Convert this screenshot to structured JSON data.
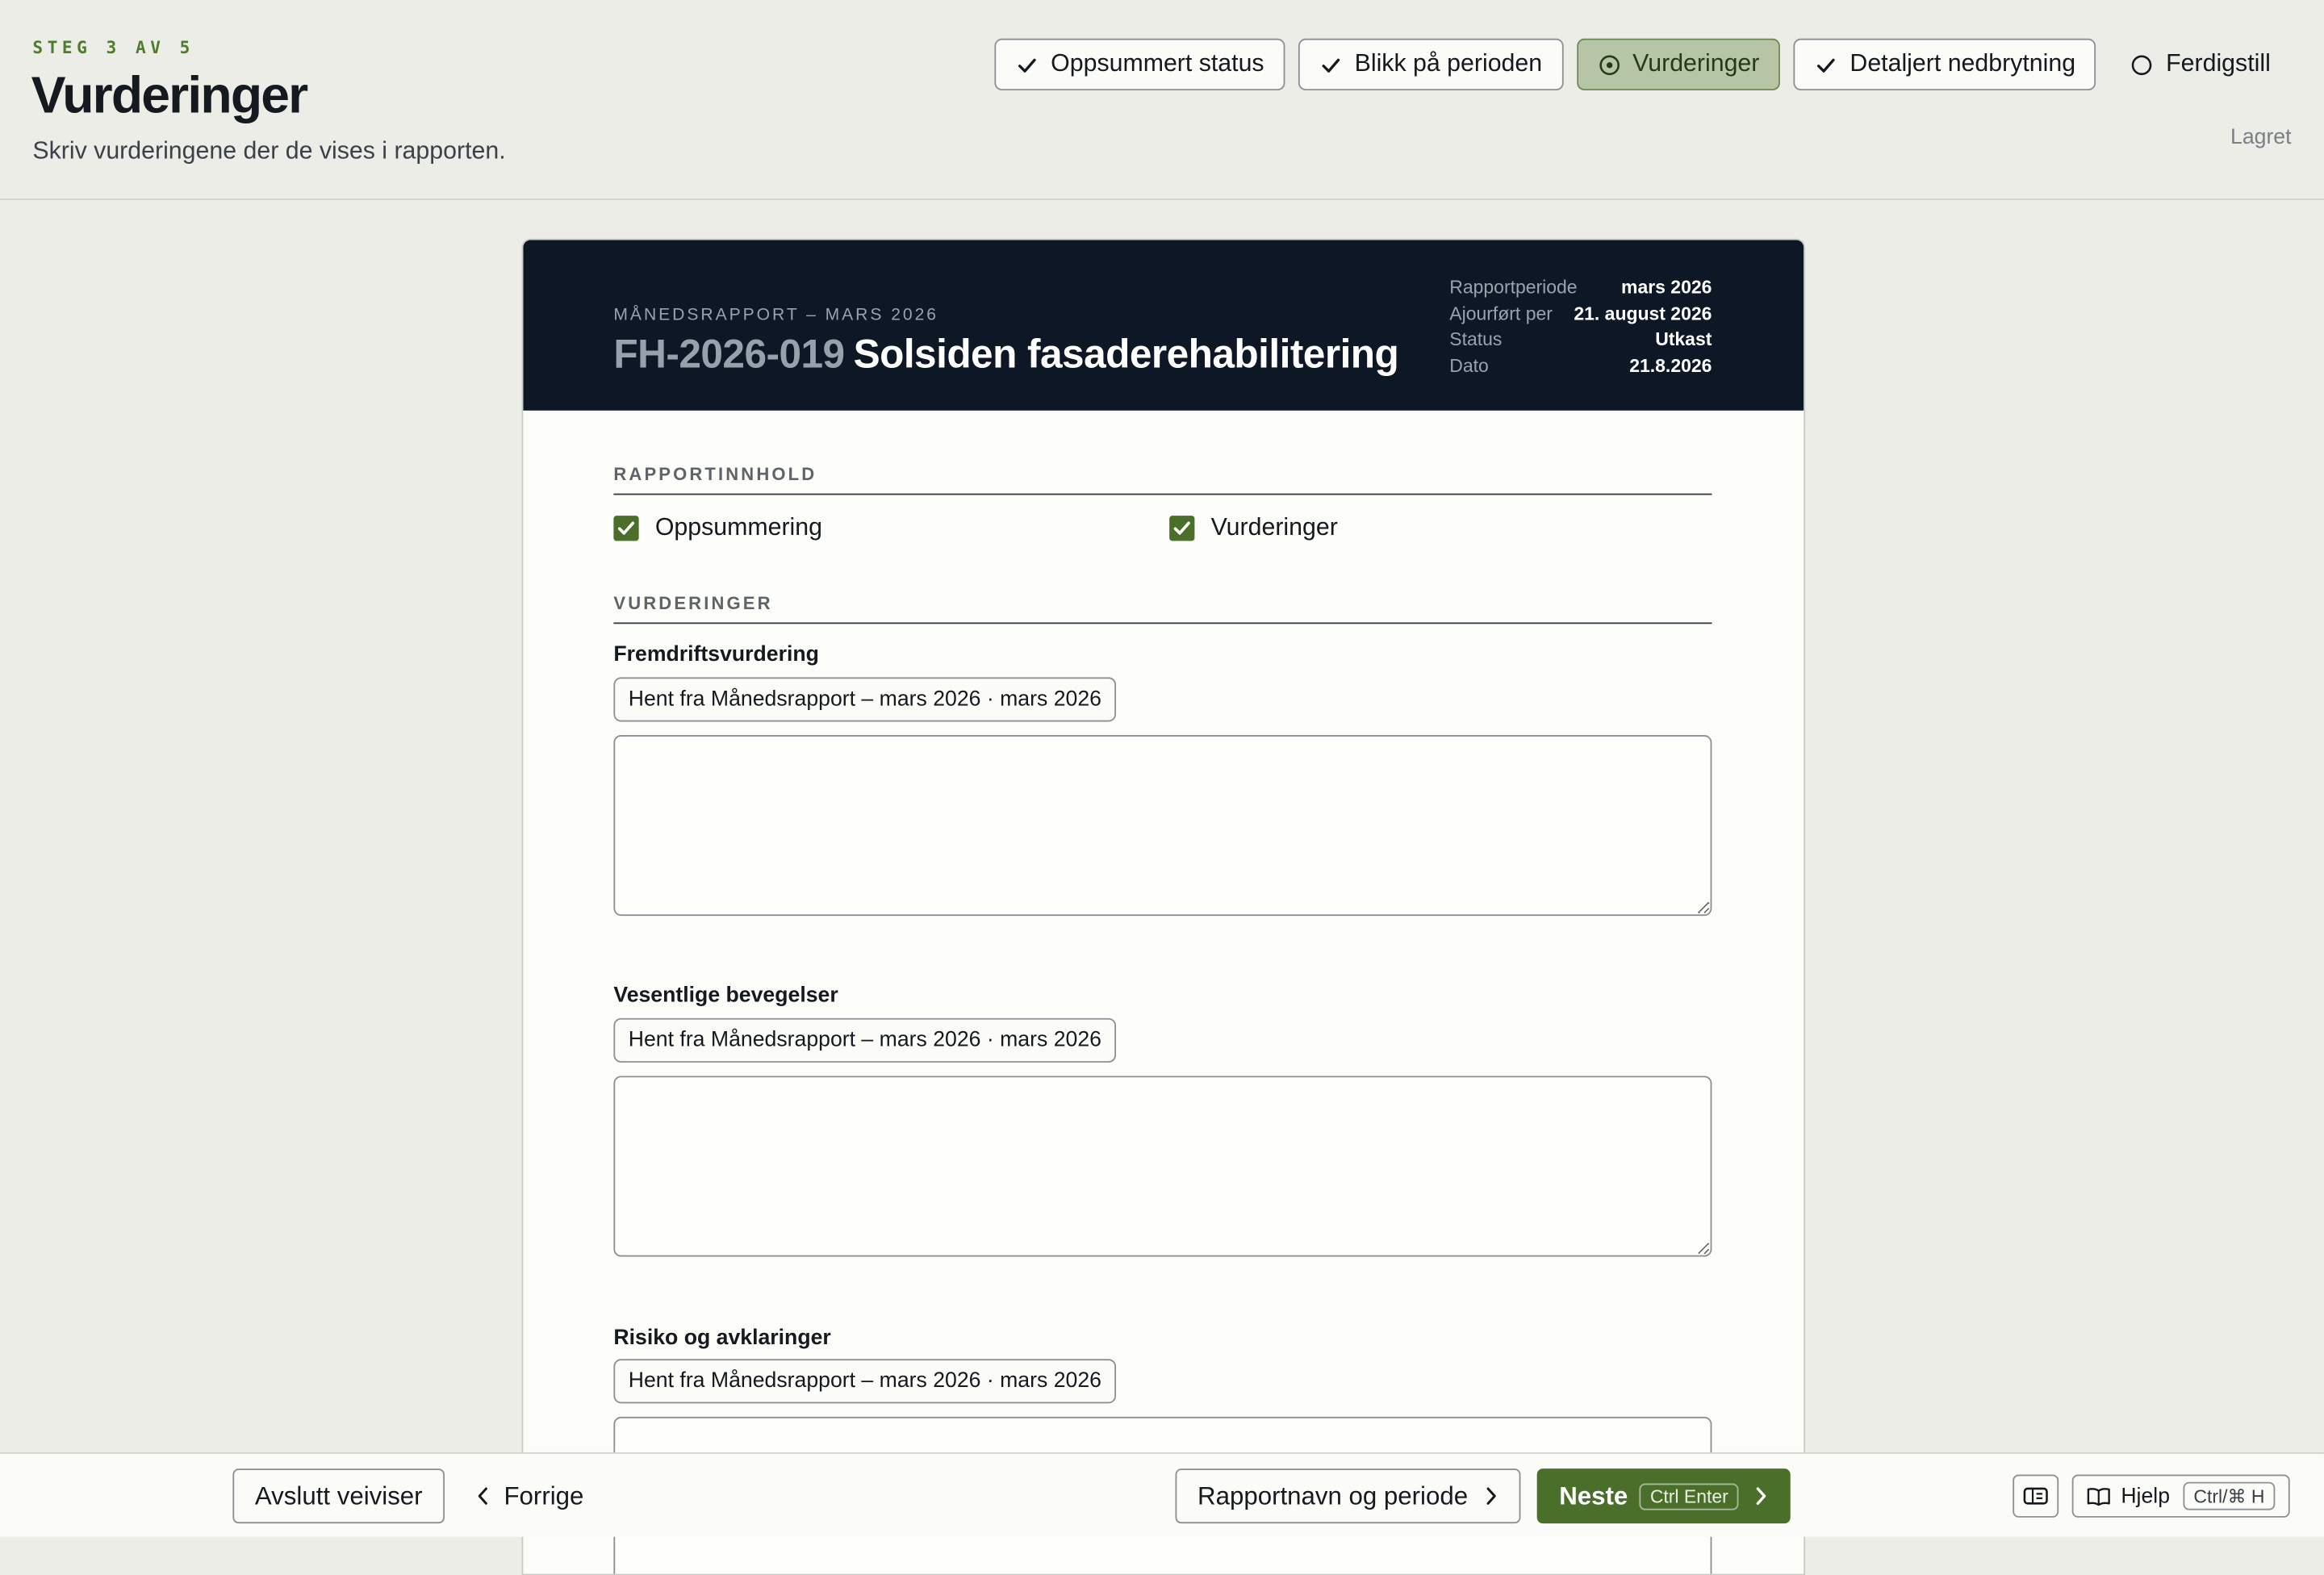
{
  "header": {
    "step": "STEG 3 AV 5",
    "title": "Vurderinger",
    "subtitle": "Skriv vurderingene der de vises i rapporten.",
    "saved": "Lagret",
    "steps": [
      {
        "label": "Oppsummert status",
        "state": "done"
      },
      {
        "label": "Blikk på perioden",
        "state": "done"
      },
      {
        "label": "Vurderinger",
        "state": "active"
      },
      {
        "label": "Detaljert nedbrytning",
        "state": "done"
      },
      {
        "label": "Ferdigstill",
        "state": "todo"
      }
    ]
  },
  "document": {
    "kicker": "MÅNEDSRAPPORT – MARS 2026",
    "code": "FH-2026-019",
    "name": "Solsiden fasaderehabilitering",
    "meta": [
      {
        "key": "Rapportperiode",
        "value": "mars 2026"
      },
      {
        "key": "Ajourført per",
        "value": "21. august 2026"
      },
      {
        "key": "Status",
        "value": "Utkast"
      },
      {
        "key": "Dato",
        "value": "21.8.2026"
      }
    ],
    "content_section": "RAPPORTINNHOLD",
    "content_options": [
      {
        "label": "Oppsummering",
        "checked": true
      },
      {
        "label": "Vurderinger",
        "checked": true
      }
    ],
    "assessments_section": "VURDERINGER",
    "fields": [
      {
        "label": "Fremdriftsvurdering",
        "fetch": "Hent fra Månedsrapport – mars 2026 · mars 2026",
        "value": ""
      },
      {
        "label": "Vesentlige bevegelser",
        "fetch": "Hent fra Månedsrapport – mars 2026 · mars 2026",
        "value": ""
      },
      {
        "label": "Risiko og avklaringer",
        "fetch": "Hent fra Månedsrapport – mars 2026 · mars 2026",
        "value": ""
      }
    ]
  },
  "footer": {
    "exit": "Avslutt veiviser",
    "back": "Forrige",
    "report_name": "Rapportnavn og periode",
    "next": "Neste",
    "next_shortcut": "Ctrl Enter",
    "help": "Hjelp",
    "help_shortcut": "Ctrl/⌘ H"
  },
  "colors": {
    "accent": "#4a6f2a",
    "active_step": "#b7c5a7",
    "doc_header": "#0e1726",
    "background": "#ebede6"
  }
}
